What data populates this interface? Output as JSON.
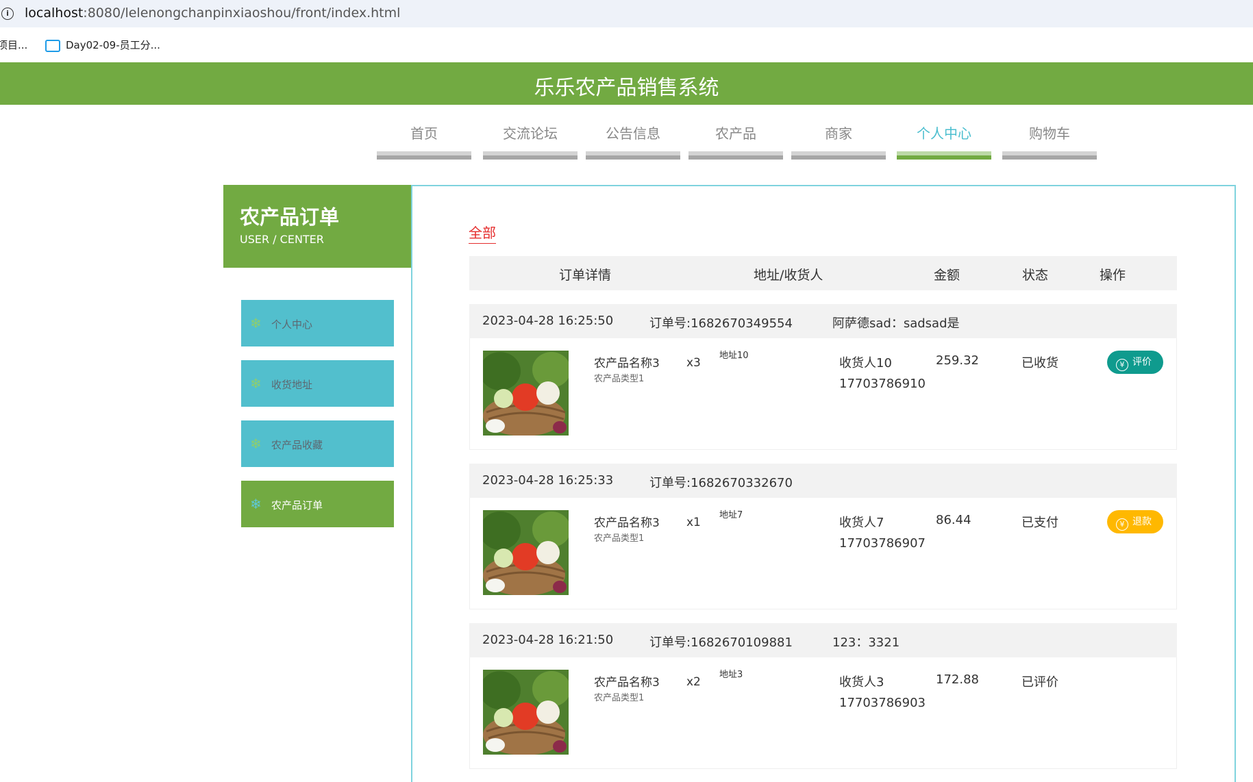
{
  "browser": {
    "url_host": "localhost",
    "url_rest": ":8080/lelenongchanpinxiaoshou/front/index.html",
    "bookmarks": [
      "项目...",
      "Day02-09-员工分..."
    ]
  },
  "header": {
    "title": "乐乐农产品销售系统"
  },
  "nav": [
    {
      "label": "首页"
    },
    {
      "label": "交流论坛"
    },
    {
      "label": "公告信息"
    },
    {
      "label": "农产品"
    },
    {
      "label": "商家"
    },
    {
      "label": "个人中心",
      "active": true
    },
    {
      "label": "购物车"
    }
  ],
  "side": {
    "title": "农产品订单",
    "subtitle": "USER / CENTER",
    "items": [
      {
        "label": "个人中心"
      },
      {
        "label": "收货地址"
      },
      {
        "label": "农产品收藏"
      },
      {
        "label": "农产品订单",
        "active": true
      }
    ]
  },
  "main": {
    "tab_all": "全部",
    "columns": [
      "订单详情",
      "地址/收货人",
      "金额",
      "状态",
      "操作"
    ],
    "orders": [
      {
        "time": "2023-04-28 16:25:50",
        "order_no": "订单号:1682670349554",
        "note": "阿萨德sad：sadsad是",
        "product_name": "农产品名称3",
        "product_type": "农产品类型1",
        "qty": "x3",
        "address": "地址10",
        "receiver": "收货人10",
        "phone": "17703786910",
        "amount": "259.32",
        "status": "已收货",
        "action": "评价",
        "action_color": "#0f9b8e"
      },
      {
        "time": "2023-04-28 16:25:33",
        "order_no": "订单号:1682670332670",
        "note": "",
        "product_name": "农产品名称3",
        "product_type": "农产品类型1",
        "qty": "x1",
        "address": "地址7",
        "receiver": "收货人7",
        "phone": "17703786907",
        "amount": "86.44",
        "status": "已支付",
        "action": "退款",
        "action_color": "#ffb800"
      },
      {
        "time": "2023-04-28 16:21:50",
        "order_no": "订单号:1682670109881",
        "note": "123：3321",
        "product_name": "农产品名称3",
        "product_type": "农产品类型1",
        "qty": "x2",
        "address": "地址3",
        "receiver": "收货人3",
        "phone": "17703786903",
        "amount": "172.88",
        "status": "已评价",
        "action": "",
        "action_color": ""
      }
    ]
  }
}
